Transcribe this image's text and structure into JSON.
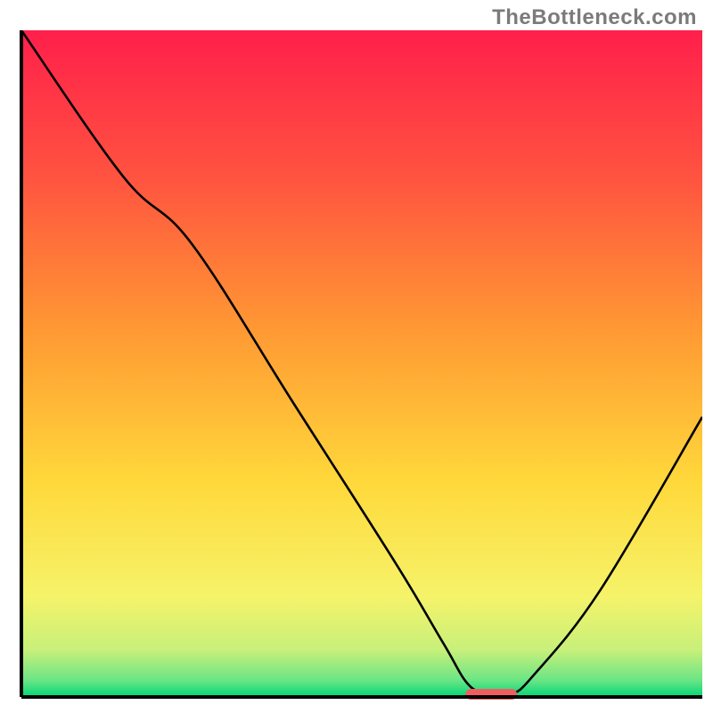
{
  "watermark": "TheBottleneck.com",
  "chart_data": {
    "type": "line",
    "title": "",
    "xlabel": "",
    "ylabel": "",
    "xlim": [
      0,
      100
    ],
    "ylim": [
      0,
      100
    ],
    "grid": false,
    "legend": false,
    "background": {
      "type": "vertical-gradient",
      "stops": [
        {
          "pos": 0.0,
          "color": "#ff1f4b"
        },
        {
          "pos": 0.22,
          "color": "#ff5340"
        },
        {
          "pos": 0.45,
          "color": "#ff9933"
        },
        {
          "pos": 0.68,
          "color": "#ffd93b"
        },
        {
          "pos": 0.85,
          "color": "#f5f36a"
        },
        {
          "pos": 0.93,
          "color": "#c7f07a"
        },
        {
          "pos": 0.975,
          "color": "#6be585"
        },
        {
          "pos": 1.0,
          "color": "#00d776"
        }
      ]
    },
    "series": [
      {
        "name": "bottleneck-curve",
        "color": "#000000",
        "x": [
          0,
          15,
          25,
          40,
          55,
          62,
          66,
          70,
          72,
          75,
          85,
          100
        ],
        "values": [
          100,
          78,
          68,
          44,
          20,
          8,
          1.5,
          0.5,
          0.5,
          3,
          16,
          42
        ]
      }
    ],
    "marker": {
      "name": "optimal-range",
      "x_start": 66,
      "x_end": 72,
      "y": 0.4,
      "color": "#ef5d62",
      "thickness": 1.6
    },
    "axes_color": "#000000",
    "axes_width": 4
  }
}
